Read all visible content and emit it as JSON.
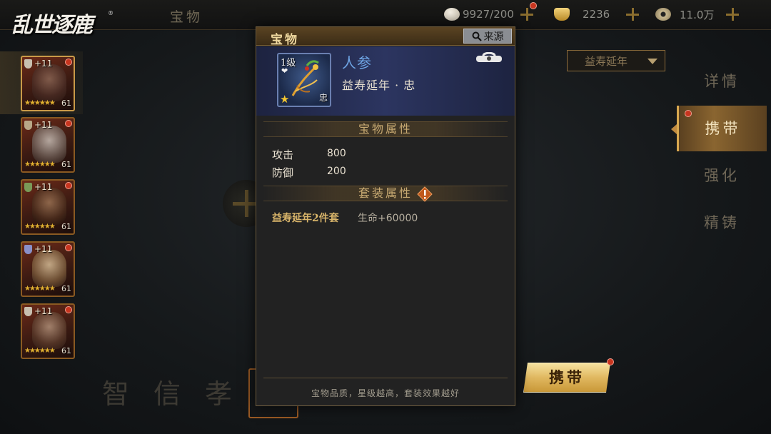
{
  "app": {
    "logo": "乱世逐鹿",
    "logo_mark": "®",
    "screen_title": "宝物"
  },
  "resources": [
    {
      "name": "stamina",
      "icon": "steamed-bun-icon",
      "value": "9927/200"
    },
    {
      "name": "gold",
      "icon": "gold-ingot-icon",
      "value": "2236"
    },
    {
      "name": "coins",
      "icon": "copper-coin-icon",
      "value": "11.0万"
    }
  ],
  "heroes": [
    {
      "plus": "+11",
      "level": "61",
      "stars": "★★★★★★",
      "selected": true
    },
    {
      "plus": "+11",
      "level": "61",
      "stars": "★★★★★★",
      "selected": false
    },
    {
      "plus": "+11",
      "level": "61",
      "stars": "★★★★★★",
      "selected": false
    },
    {
      "plus": "+11",
      "level": "61",
      "stars": "★★★★★★",
      "selected": false
    },
    {
      "plus": "+11",
      "level": "61",
      "stars": "★★★★★★",
      "selected": false
    }
  ],
  "slots": [
    "智",
    "信",
    "孝"
  ],
  "suit_dropdown": {
    "selected": "益寿延年"
  },
  "right_tabs": [
    {
      "label": "详情",
      "active": false
    },
    {
      "label": "携带",
      "active": true
    },
    {
      "label": "强化",
      "active": false
    },
    {
      "label": "精铸",
      "active": false
    }
  ],
  "carry_button": "携带",
  "popup": {
    "title": "宝物",
    "source_button": "来源",
    "item": {
      "level": "1级",
      "badge": "忠",
      "name": "人参",
      "suit_line": "益寿延年 · 忠",
      "stars": 1
    },
    "attr_section_title": "宝物属性",
    "attributes": [
      {
        "name": "攻击",
        "value": "800"
      },
      {
        "name": "防御",
        "value": "200"
      }
    ],
    "set_section_title": "套装属性",
    "set_bonus": {
      "name": "益寿延年2件套",
      "effect": "生命+60000"
    },
    "tip": "宝物品质，星级越高，套装效果越好"
  },
  "colors": {
    "accent_gold": "#d8a850",
    "item_name_blue": "#6fa6e6",
    "set_name_gold": "#d9b56a",
    "red_dot": "#c8351f"
  }
}
